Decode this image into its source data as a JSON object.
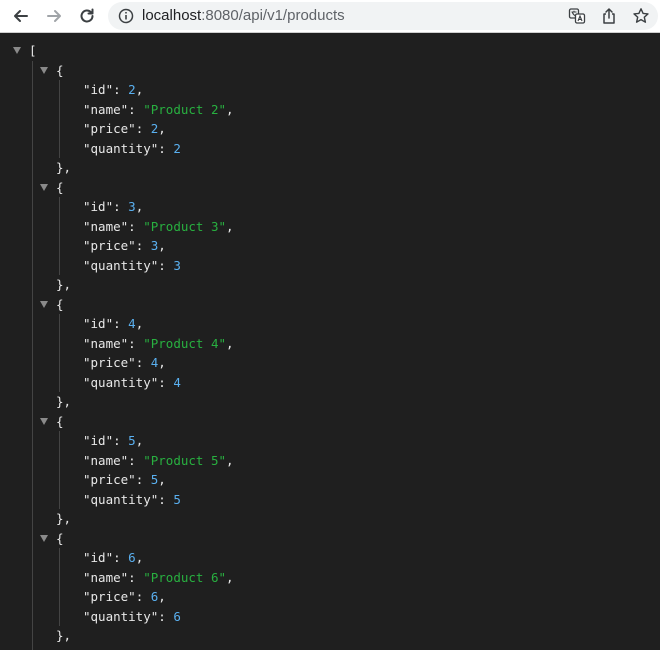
{
  "browser": {
    "url_host": "localhost",
    "url_path": ":8080/api/v1/products",
    "back_icon": "arrow-left-icon",
    "forward_icon": "arrow-right-icon",
    "reload_icon": "reload-icon",
    "info_icon": "info-icon",
    "translate_icon": "translate-icon",
    "share_icon": "share-icon",
    "bookmark_icon": "star-icon"
  },
  "json": {
    "open_bracket": "[",
    "open_brace": "{",
    "close_brace": "},",
    "key_id": "\"id\"",
    "key_name": "\"name\"",
    "key_price": "\"price\"",
    "key_quantity": "\"quantity\"",
    "colon": ": ",
    "comma": ",",
    "items": [
      {
        "id": "2",
        "name": "\"Product 2\"",
        "price": "2",
        "quantity": "2"
      },
      {
        "id": "3",
        "name": "\"Product 3\"",
        "price": "3",
        "quantity": "3"
      },
      {
        "id": "4",
        "name": "\"Product 4\"",
        "price": "4",
        "quantity": "4"
      },
      {
        "id": "5",
        "name": "\"Product 5\"",
        "price": "5",
        "quantity": "5"
      },
      {
        "id": "6",
        "name": "\"Product 6\"",
        "price": "6",
        "quantity": "6"
      }
    ]
  },
  "colors": {
    "background": "#1f1f1f",
    "string": "#28b040",
    "number": "#5ab0f0",
    "text": "#e8e8e8"
  }
}
